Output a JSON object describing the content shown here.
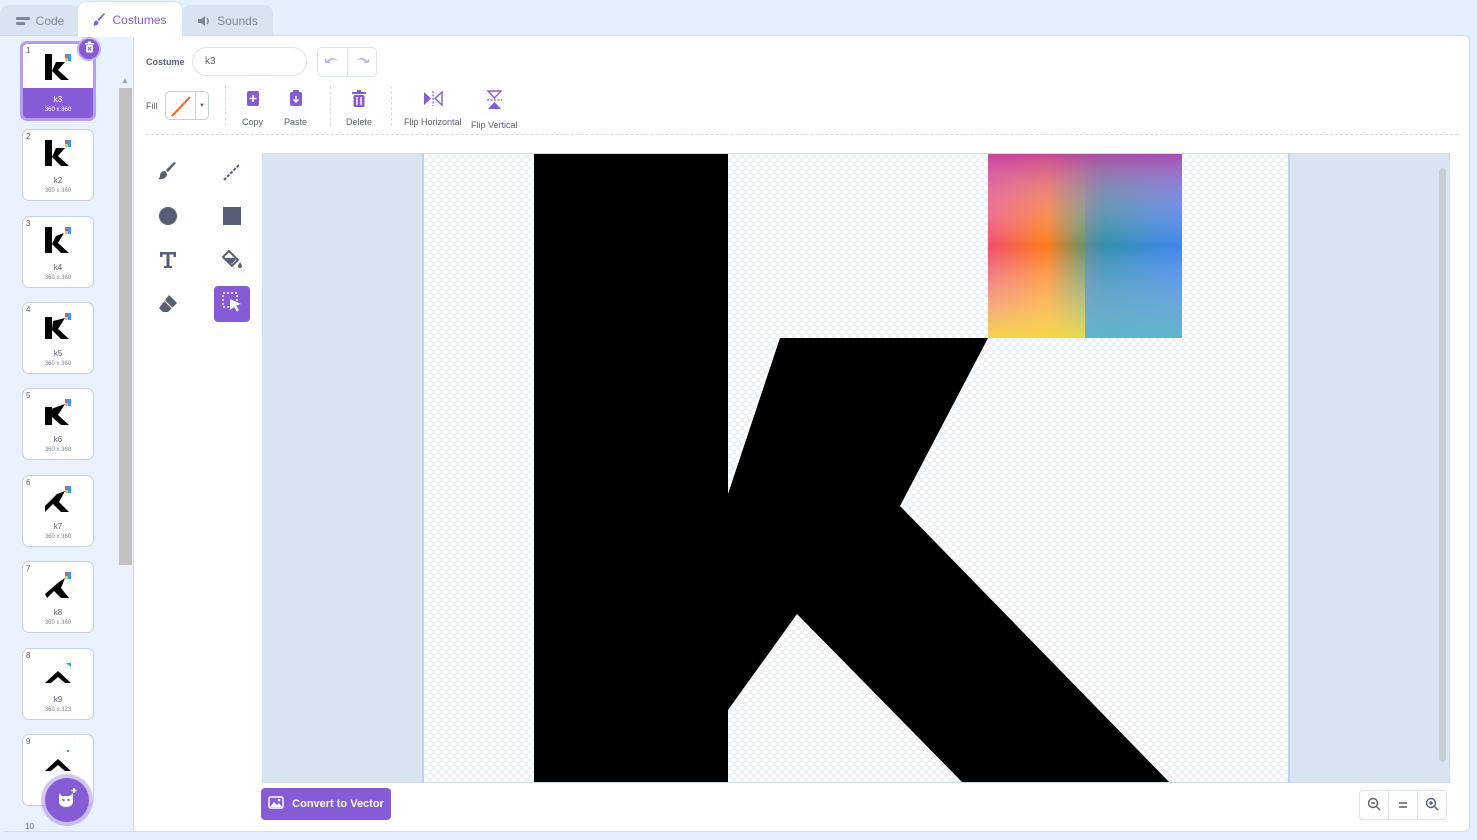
{
  "tabs": [
    {
      "label": "Code",
      "icon": "code-icon"
    },
    {
      "label": "Costumes",
      "icon": "brush-icon"
    },
    {
      "label": "Sounds",
      "icon": "speaker-icon"
    }
  ],
  "costumes": [
    {
      "num": "1",
      "name": "k3",
      "size": "360 x 360"
    },
    {
      "num": "2",
      "name": "k2",
      "size": "360 x 360"
    },
    {
      "num": "3",
      "name": "k4",
      "size": "360 x 360"
    },
    {
      "num": "4",
      "name": "k5",
      "size": "360 x 360"
    },
    {
      "num": "5",
      "name": "k6",
      "size": "360 x 360"
    },
    {
      "num": "6",
      "name": "k7",
      "size": "360 x 360"
    },
    {
      "num": "7",
      "name": "k8",
      "size": "360 x 360"
    },
    {
      "num": "8",
      "name": "k9",
      "size": "360 x 323"
    },
    {
      "num": "9",
      "name": "",
      "size": ""
    },
    {
      "num": "10",
      "name": "",
      "size": ""
    }
  ],
  "editor": {
    "costume_label": "Costume",
    "costume_name": "k3",
    "fill_label": "Fill",
    "fill_color": "none",
    "actions": {
      "copy": "Copy",
      "paste": "Paste",
      "delete": "Delete",
      "flip_h": "Flip Horizontal",
      "flip_v": "Flip Vertical"
    },
    "tools": [
      "brush-icon",
      "line-icon",
      "circle-icon",
      "rectangle-icon",
      "text-icon",
      "fill-icon",
      "eraser-icon",
      "select-icon"
    ],
    "active_tool": "select-icon",
    "convert_label": "Convert to Vector",
    "zoom": {
      "out": "-",
      "reset": "=",
      "in": "+"
    }
  },
  "colors": {
    "accent": "#855cd6",
    "panel_bg": "#e9f1fc"
  }
}
